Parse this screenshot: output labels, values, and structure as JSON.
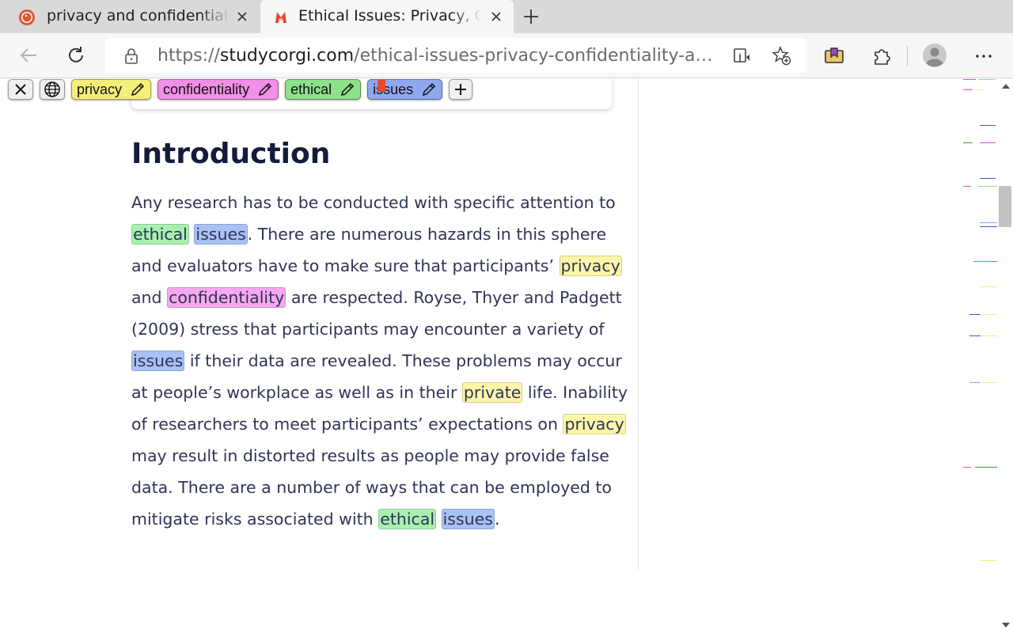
{
  "tabs": [
    {
      "title": "privacy and confidentiality"
    },
    {
      "title": "Ethical Issues: Privacy, Confidentiality"
    }
  ],
  "address": {
    "scheme": "https://",
    "host": "studycorgi.com",
    "path": "/ethical-issues-privacy-confidentiality-an…"
  },
  "keywords": [
    {
      "label": "privacy",
      "color": "#f5ee7a"
    },
    {
      "label": "confidentiality",
      "color": "#f28fe6"
    },
    {
      "label": "ethical",
      "color": "#8fe08a"
    },
    {
      "label": "issues",
      "color": "#8fa8f0"
    }
  ],
  "article": {
    "heading": "Introduction",
    "lines": [
      [
        {
          "t": "Any research has to be conducted with specific attention to"
        }
      ],
      [
        {
          "t": "ethical",
          "k": "ethical"
        },
        {
          "t": " "
        },
        {
          "t": "issues",
          "k": "issues"
        },
        {
          "t": ". There are numerous hazards in this sphere"
        }
      ],
      [
        {
          "t": "and evaluators have to make sure that participants’ "
        },
        {
          "t": "privacy",
          "k": "privacy"
        }
      ],
      [
        {
          "t": "and "
        },
        {
          "t": "confidentiality",
          "k": "confidentiality"
        },
        {
          "t": " are respected. Royse, Thyer and Padgett"
        }
      ],
      [
        {
          "t": "(2009) stress that participants may encounter a variety of"
        }
      ],
      [
        {
          "t": "issues",
          "k": "issues"
        },
        {
          "t": " if their data are revealed. These problems may occur"
        }
      ],
      [
        {
          "t": "at people’s workplace as well as in their "
        },
        {
          "t": "private",
          "k": "privacy"
        },
        {
          "t": " life. Inability"
        }
      ],
      [
        {
          "t": "of researchers to meet participants’ expectations on "
        },
        {
          "t": "privacy",
          "k": "privacy"
        }
      ],
      [
        {
          "t": "may result in distorted results as people may provide false"
        }
      ],
      [
        {
          "t": "data. There are a number of ways that can be employed to"
        }
      ],
      [
        {
          "t": "mitigate risks associated with "
        },
        {
          "t": "ethical",
          "k": "ethical"
        },
        {
          "t": " "
        },
        {
          "t": "issues",
          "k": "issues"
        },
        {
          "t": "."
        }
      ]
    ]
  },
  "highlight_colors": {
    "privacy": "#fbf6a8",
    "confidentiality": "#f7a8ef",
    "ethical": "#a8f0b0",
    "issues": "#a9c2f5"
  },
  "icons": {
    "tab1_favicon": "duckduckgo-icon",
    "tab2_favicon": "studycorgi-icon",
    "back": "back-arrow-icon",
    "reload": "reload-icon",
    "lock": "lock-icon",
    "read_aloud": "read-aloud-icon",
    "favorite": "add-favorite-icon",
    "collections": "collections-icon",
    "extensions": "puzzle-icon",
    "profile": "profile-icon",
    "menu": "more-menu-icon"
  }
}
